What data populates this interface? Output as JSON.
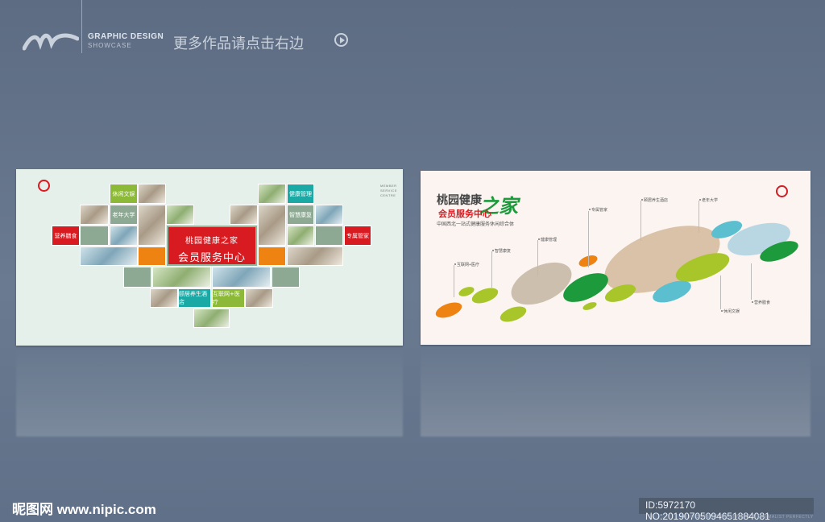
{
  "header": {
    "brand_line1": "GRAPHIC DESIGN",
    "brand_line2": "SHOWCASE",
    "more_text": "更多作品请点击右边"
  },
  "left_board": {
    "center_line1": "桃园健康之家",
    "center_line2": "会员服务中心",
    "tiles": {
      "leisure": "休闲文娱",
      "university": "老年大学",
      "nutrition": "营养膳食",
      "health_mgmt": "健康管理",
      "smart_rehab": "智慧康复",
      "butler": "专属管家",
      "hotel": "颐居养生酒店",
      "internet_medical": "互联网+医疗"
    },
    "member_service": "MEMBER SERVICE CENTRE"
  },
  "right_board": {
    "title1": "桃园健康",
    "title_jia": "之家",
    "title2": "会员服务中心",
    "subtitle": "中国西北一站式健康服务休闲综合体",
    "labels": [
      "互联网+医疗",
      "智慧康复",
      "健康管理",
      "专属管家",
      "颐居养生酒店",
      "老年大学",
      "休闲文娱",
      "营养膳食"
    ]
  },
  "footer": {
    "site": "昵图网 www.nipic.com",
    "id_text": "ID:5972170 NO:20190705094651884081",
    "slogan": "TO FIND THEIR OWN STYLE, THE MINIMALIST PERFECTLY"
  },
  "colors": {
    "red": "#d81a21",
    "green": "#8cb938",
    "teal": "#1aa9a5",
    "orange": "#ef8311",
    "dark_green": "#1d9a3c",
    "sky": "#5bbfd0"
  }
}
